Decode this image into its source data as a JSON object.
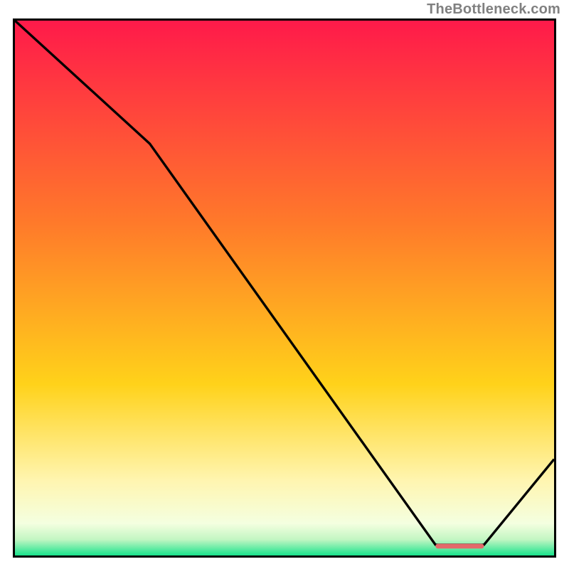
{
  "attribution": "TheBottleneck.com",
  "colors": {
    "top": "#ff1a4a",
    "mid1": "#ff7a2a",
    "mid2": "#ffd21a",
    "mid3": "#fff5b0",
    "bottom": "#19e38c",
    "line": "#000000",
    "marker": "#e36a6a"
  },
  "chart_data": {
    "type": "line",
    "title": "",
    "xlabel": "",
    "ylabel": "",
    "xlim": [
      0,
      100
    ],
    "ylim": [
      0,
      100
    ],
    "x": [
      0,
      25,
      78,
      87,
      100
    ],
    "values": [
      100,
      77,
      2,
      2,
      18
    ],
    "annotations": [
      {
        "kind": "optimum-band",
        "x_start": 78,
        "x_end": 87,
        "y": 2
      }
    ],
    "gradient_stops_pct": [
      0,
      38,
      68,
      86,
      95,
      100
    ]
  }
}
